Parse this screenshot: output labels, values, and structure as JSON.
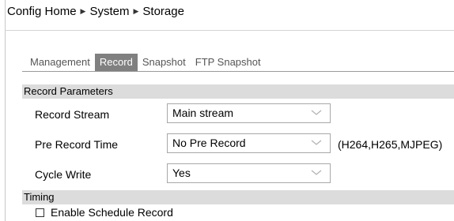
{
  "breadcrumb": [
    "Config Home",
    "System",
    "Storage"
  ],
  "tabs": [
    {
      "label": "Management",
      "active": false
    },
    {
      "label": "Record",
      "active": true
    },
    {
      "label": "Snapshot",
      "active": false
    },
    {
      "label": "FTP Snapshot",
      "active": false
    }
  ],
  "record_parameters": {
    "header": "Record Parameters",
    "record_stream": {
      "label": "Record Stream",
      "value": "Main stream"
    },
    "pre_record_time": {
      "label": "Pre Record Time",
      "value": "No Pre Record",
      "hint": "(H264,H265,MJPEG)"
    },
    "cycle_write": {
      "label": "Cycle Write",
      "value": "Yes"
    }
  },
  "timing": {
    "header": "Timing",
    "enable_schedule": {
      "label": "Enable Schedule Record",
      "checked": false
    }
  },
  "colors": {
    "active_tab_bg": "#808080",
    "section_header_bg": "#dcdcdc"
  },
  "icons": {
    "breadcrumb_separator": "triangle-right-icon",
    "select_arrow": "chevron-down-icon"
  }
}
